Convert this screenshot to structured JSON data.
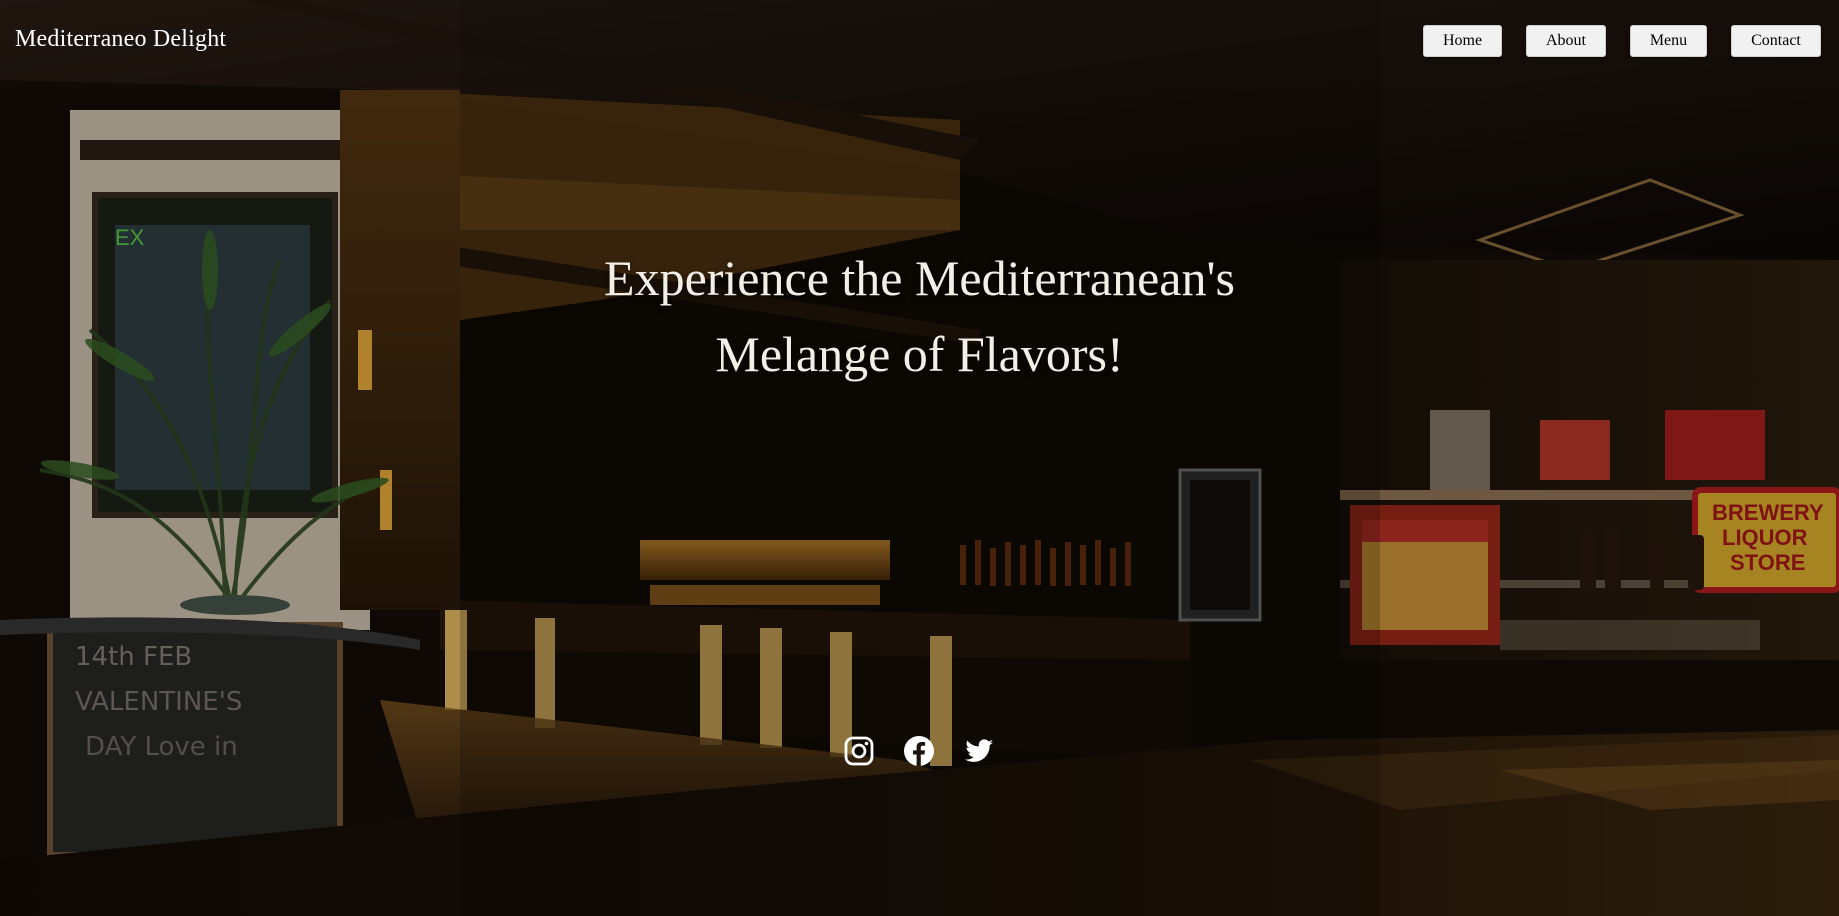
{
  "header": {
    "brand": "Mediterraneo Delight",
    "nav": [
      {
        "label": "Home"
      },
      {
        "label": "About"
      },
      {
        "label": "Menu"
      },
      {
        "label": "Contact"
      }
    ]
  },
  "hero": {
    "line1": "Experience the Mediterranean's",
    "line2": "Melange of Flavors!"
  },
  "social": [
    {
      "icon": "instagram-icon"
    },
    {
      "icon": "facebook-icon"
    },
    {
      "icon": "twitter-icon"
    }
  ],
  "colors": {
    "nav_button_bg": "#f1f1f1",
    "hero_text": "#f4efe6",
    "header_overlay": "#140e0a"
  }
}
